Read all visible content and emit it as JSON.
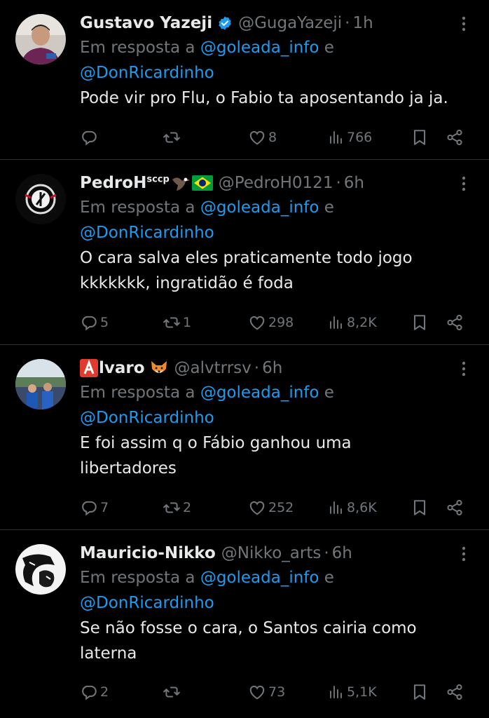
{
  "reply_prefix": "Em resposta a",
  "reply_joiner": "e",
  "tweets": [
    {
      "name": "Gustavo Yazeji",
      "handle": "@GugaYazeji",
      "time": "1h",
      "verified": true,
      "mentions": [
        "@goleada_info",
        "@DonRicardinho"
      ],
      "text": [
        "Pode vir pro Flu, o Fabio ta aposentando ja ja."
      ],
      "replies": "",
      "retweets": "",
      "likes": "8",
      "views": "766"
    },
    {
      "name": "PedroH",
      "name_sup": "sccp",
      "badges": [
        "eagle-emoji",
        "brazil-flag-emoji"
      ],
      "handle": "@PedroH0121",
      "time": "6h",
      "mentions": [
        "@goleada_info",
        "@DonRicardinho"
      ],
      "text": [
        "O cara salva eles praticamente todo jogo",
        "kkkkkkk, ingratidão é foda"
      ],
      "replies": "5",
      "retweets": "1",
      "likes": "298",
      "views": "8,2K"
    },
    {
      "name": "lvaro",
      "name_prefix_emoji": "red-A-emoji",
      "badges": [
        "fox-emoji"
      ],
      "handle": "@alvtrrsv",
      "time": "6h",
      "mentions": [
        "@goleada_info",
        "@DonRicardinho"
      ],
      "text": [
        "E foi assim q o Fábio ganhou uma",
        "libertadores"
      ],
      "replies": "7",
      "retweets": "2",
      "likes": "252",
      "views": "8,6K"
    },
    {
      "name": "Mauricio-Nikko",
      "handle": "@Nikko_arts",
      "time": "6h",
      "mentions": [
        "@goleada_info",
        "@DonRicardinho"
      ],
      "text": [
        "Se não fosse o cara, o Santos cairia como",
        "laterna"
      ],
      "replies": "2",
      "retweets": "",
      "likes": "73",
      "views": "5,1K"
    }
  ],
  "colors": {
    "background": "#000000",
    "text": "#e7e9ea",
    "muted": "#71767b",
    "link": "#1d9bf0",
    "divider": "#2f3336"
  }
}
